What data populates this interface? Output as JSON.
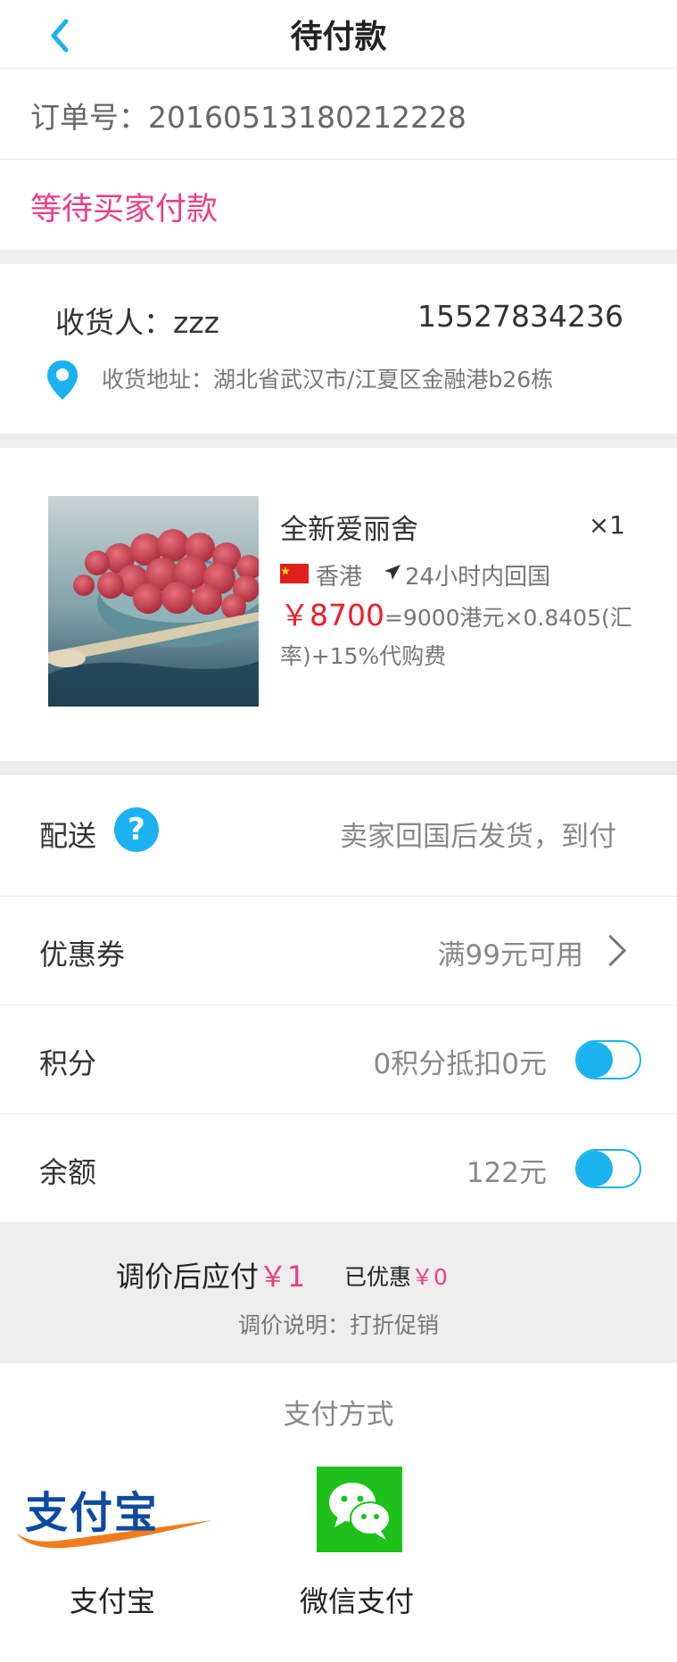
{
  "header": {
    "title": "待付款",
    "back_icon": "chevron-left-icon"
  },
  "order": {
    "label": "订单号：",
    "number": "20160513180212228",
    "status": "等待买家付款"
  },
  "address": {
    "recipient_label": "收货人：",
    "recipient": "zzz",
    "phone": "15527834236",
    "address_label": "收货地址：",
    "address": "湖北省武汉市/江夏区金融港b26栋",
    "pin_icon": "location-pin-icon"
  },
  "product": {
    "name": "全新爱丽舍",
    "quantity": "×1",
    "region": "香港",
    "shipping": "24小时内回国",
    "currency": "￥",
    "price": "8700",
    "price_note": "=9000港元×0.8405(汇率)+15%代购费",
    "image_icon": "product-image-raspberries"
  },
  "options": {
    "delivery": {
      "label": "配送",
      "help": "?",
      "value": "卖家回国后发货，到付"
    },
    "coupon": {
      "label": "优惠券",
      "value": "满99元可用"
    },
    "points": {
      "label": "积分",
      "value": "0积分抵扣0元",
      "toggle_on": false
    },
    "balance": {
      "label": "余额",
      "value": "122元",
      "toggle_on": false
    }
  },
  "adjust": {
    "label": "调价后应付",
    "amount": "￥1",
    "discount_label": "已优惠",
    "discount": "￥0",
    "note": "调价说明：打折促销"
  },
  "payment": {
    "title": "支付方式",
    "methods": [
      {
        "label": "支付宝",
        "icon": "alipay-logo"
      },
      {
        "label": "微信支付",
        "icon": "wechat-pay-icon"
      }
    ]
  },
  "colors": {
    "accent": "#1ab3ef",
    "pink": "#ee3d86",
    "price_red": "#ea1f28",
    "wechat_green": "#1dc11a",
    "alipay_blue": "#0e4aa0"
  }
}
